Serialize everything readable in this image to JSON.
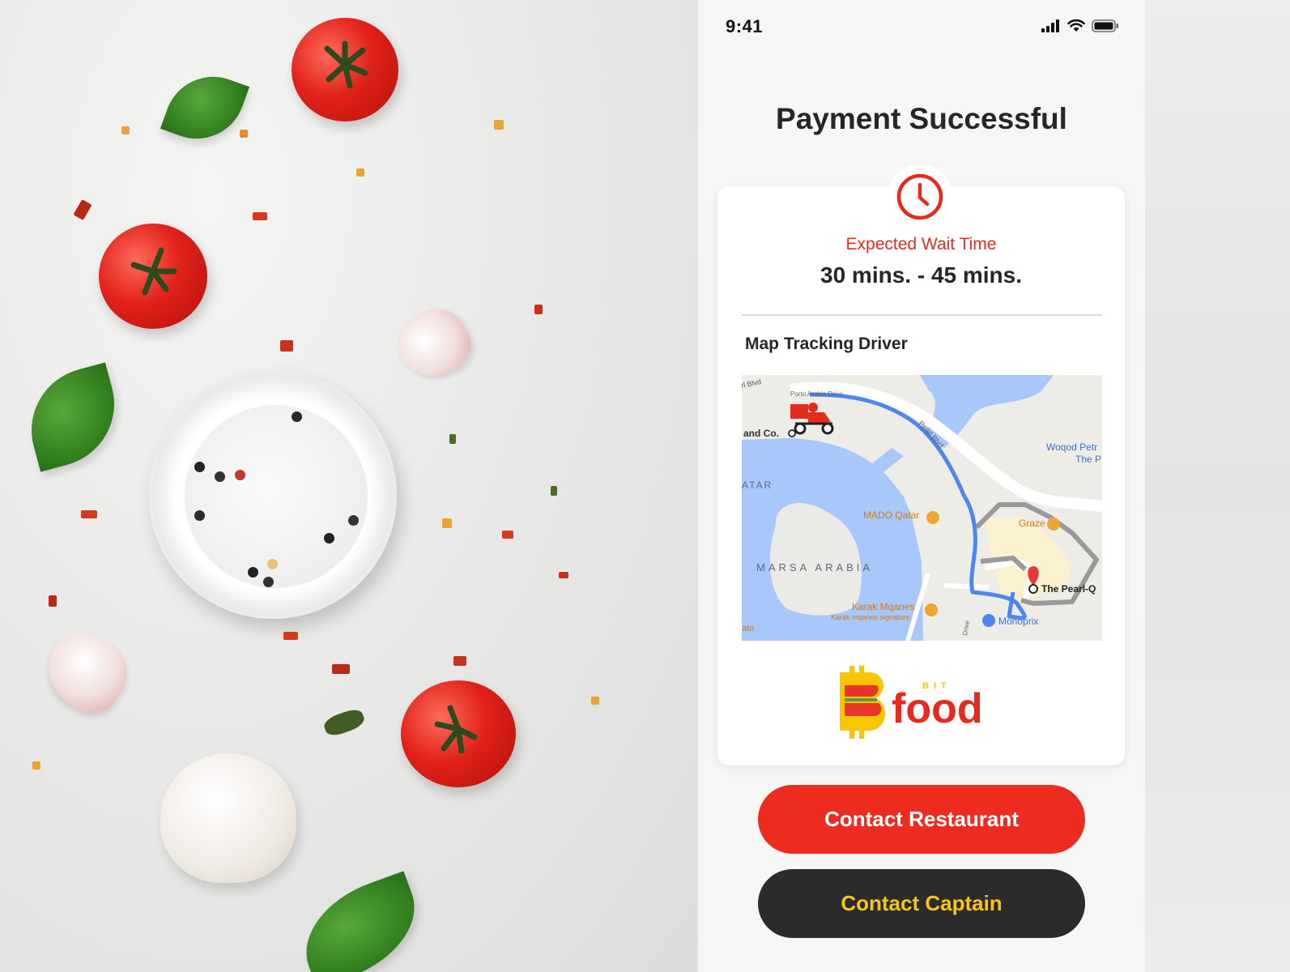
{
  "status_bar": {
    "time": "9:41"
  },
  "page": {
    "title": "Payment Successful"
  },
  "card": {
    "wait_label": "Expected Wait Time",
    "wait_value": "30 mins. - 45 mins.",
    "map_title": "Map Tracking Driver"
  },
  "map": {
    "labels": {
      "street_1": "rl Blvd",
      "street_2": "Porto Arabia Drive",
      "street_3": "Pearl Blvd",
      "place_1": "and Co.",
      "place_2": "ATAR",
      "place_3": "Woqod Petr",
      "place_4": "The P",
      "place_5": "MADO Qatar",
      "place_6": "Graze",
      "place_7": "MARSA ARABIA",
      "place_8": "The Pearl-Q",
      "place_9": "Karak Mqanes",
      "place_10": "Karak mqanes signature",
      "place_11": "Monoprix",
      "place_12": "ato",
      "place_13": "Drive"
    }
  },
  "brand": {
    "logo_small": "BIT",
    "logo_text": "food",
    "primary": "#ee2b1f",
    "accent": "#f5c518",
    "dark": "#2b2b2b"
  },
  "actions": {
    "contact_restaurant": "Contact Restaurant",
    "contact_captain": "Contact Captain"
  }
}
